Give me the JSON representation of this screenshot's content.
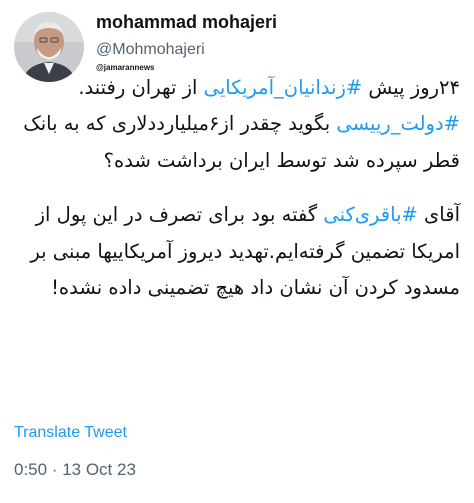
{
  "author": {
    "name": "mohammad mohajeri",
    "handle": "@Mohmohajeri",
    "watermark": "@jamarannews"
  },
  "tweet": {
    "paragraph1": [
      {
        "text": "۲۴روز پیش ",
        "tag": false
      },
      {
        "text": "#زندانیان_آمریکایی",
        "tag": true
      },
      {
        "text": " از تهران رفتند. ",
        "tag": false
      },
      {
        "text": "#دولت_رییسی",
        "tag": true
      },
      {
        "text": " بگوید چقدر از۶میلیارددلاری که به بانک قطر سپرده شد توسط ایران برداشت شده؟",
        "tag": false
      }
    ],
    "paragraph2": [
      {
        "text": "آقای ",
        "tag": false
      },
      {
        "text": "#باقری‌کنی",
        "tag": true
      },
      {
        "text": " گفته بود برای تصرف در این پول از امریکا تضمین گرفته‌ایم.تهدید دیروز آمریکاییها مبنی بر مسدود کردن آن نشان داد هیچ تضمینی داده نشده!",
        "tag": false
      }
    ]
  },
  "actions": {
    "translate_label": "Translate Tweet"
  },
  "meta": {
    "time": "0:50",
    "separator": " · ",
    "date": "13 Oct 23"
  },
  "colors": {
    "link": "#1d9bf0",
    "secondary_text": "#536471",
    "primary_text": "#0f1419"
  }
}
